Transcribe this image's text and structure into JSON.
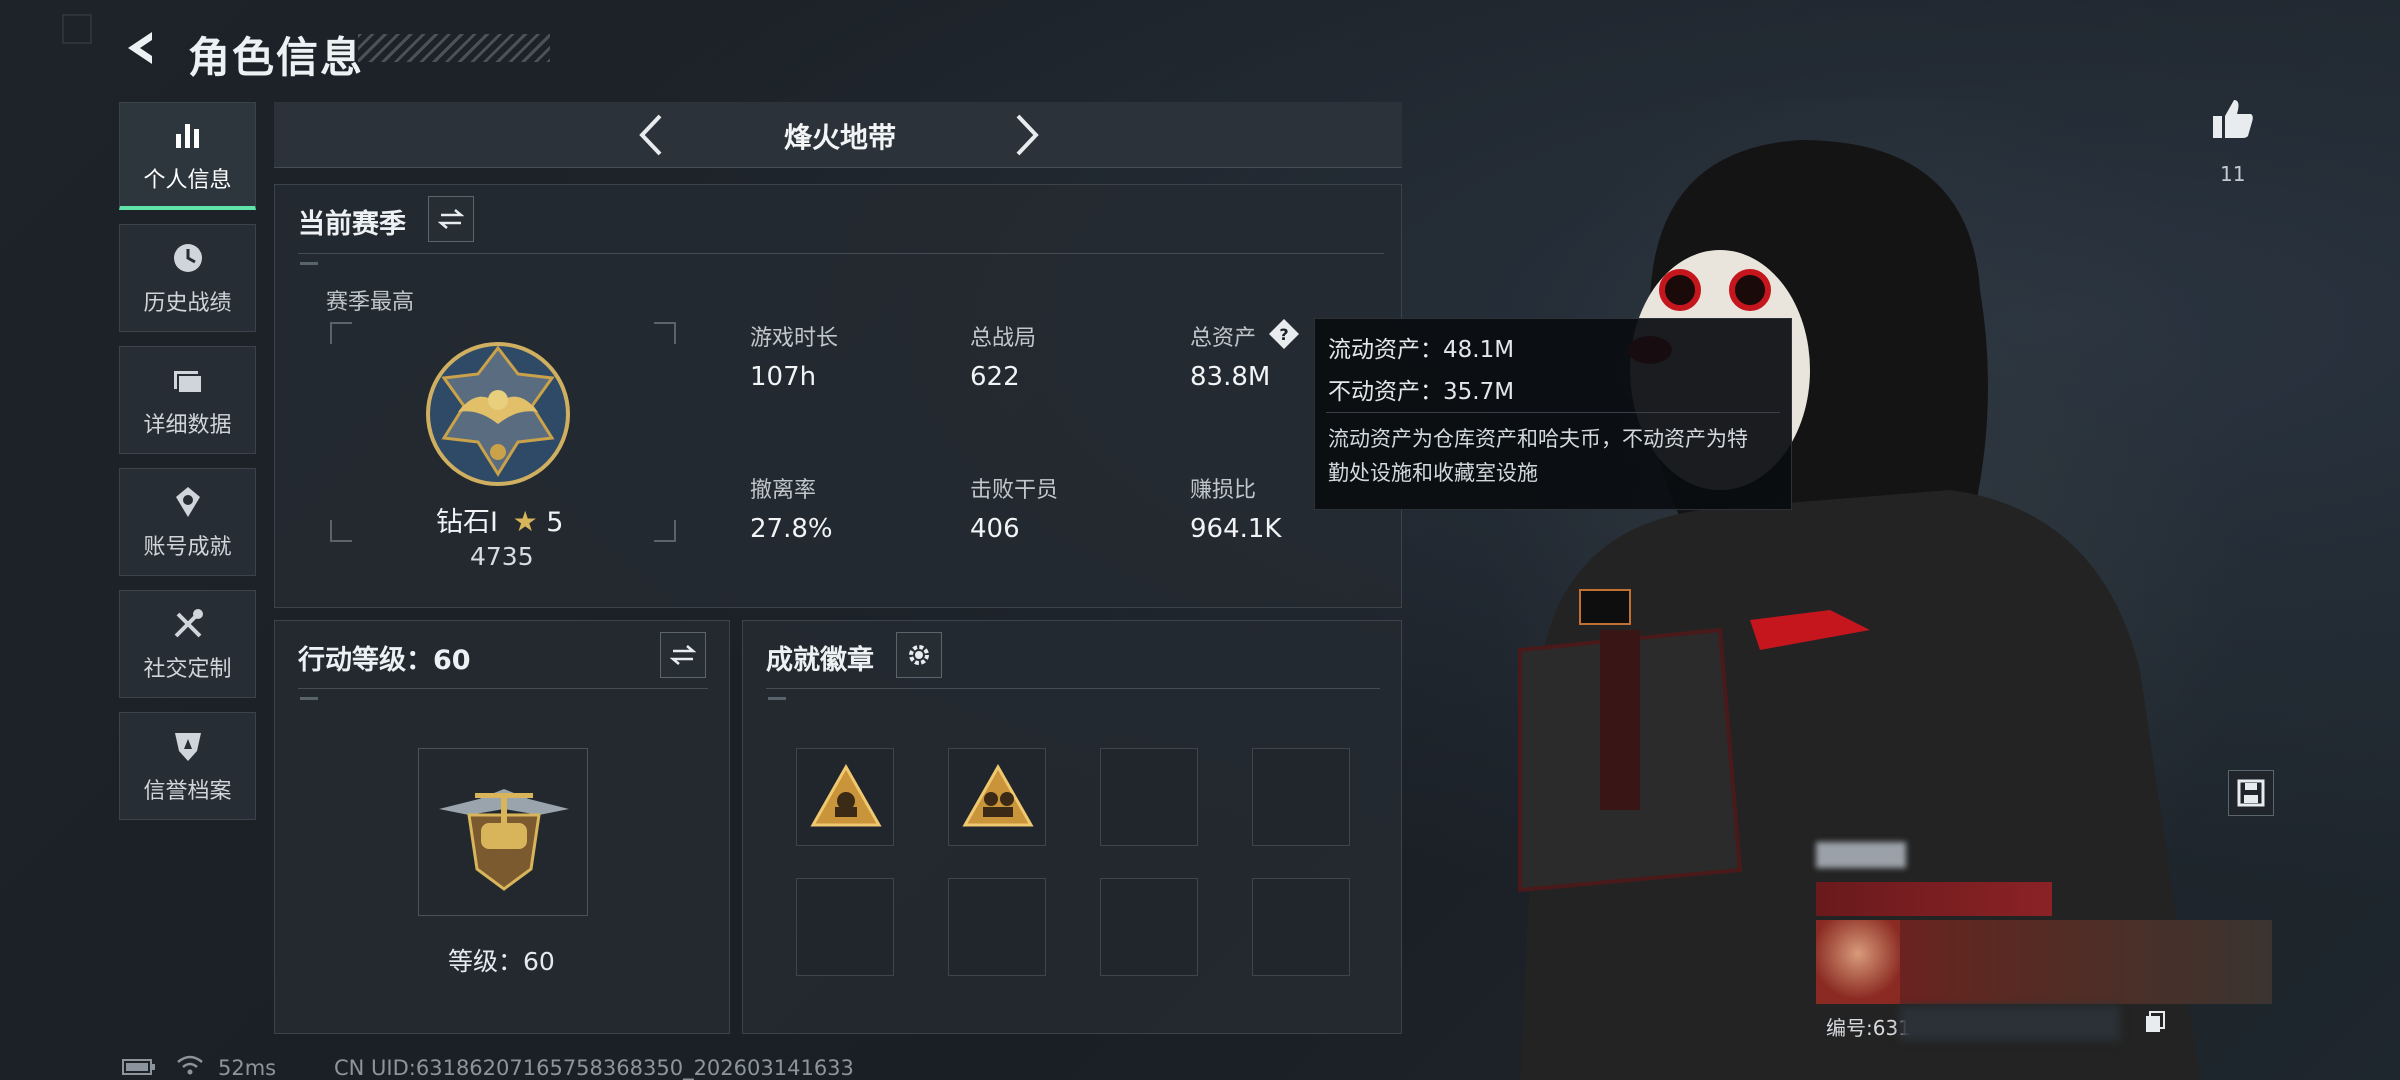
{
  "header": {
    "title": "角色信息"
  },
  "sidebar": {
    "items": [
      {
        "label": "个人信息",
        "icon": "bar-chart-icon",
        "active": true
      },
      {
        "label": "历史战绩",
        "icon": "clock-icon"
      },
      {
        "label": "详细数据",
        "icon": "folder-icon"
      },
      {
        "label": "账号成就",
        "icon": "achievement-icon"
      },
      {
        "label": "社交定制",
        "icon": "tools-icon"
      },
      {
        "label": "信誉档案",
        "icon": "shield-icon"
      }
    ]
  },
  "mode": {
    "title": "烽火地带"
  },
  "season": {
    "title": "当前赛季",
    "highest_label": "赛季最高",
    "rank_name": "钻石Ⅰ",
    "rank_stars": "5",
    "rank_points": "4735",
    "stats": [
      {
        "label": "游戏时长",
        "value": "107h"
      },
      {
        "label": "总战局",
        "value": "622"
      },
      {
        "label": "总资产",
        "value": "83.8M"
      },
      {
        "label": "撤离率",
        "value": "27.8%"
      },
      {
        "label": "击败干员",
        "value": "406"
      },
      {
        "label": "赚损比",
        "value": "964.1K"
      }
    ]
  },
  "tooltip": {
    "liquid": "流动资产：48.1M",
    "fixed": "不动资产：35.7M",
    "note": "流动资产为仓库资产和哈夫币，不动资产为特勤处设施和收藏室设施"
  },
  "action_level": {
    "title": "行动等级：60",
    "level_text": "等级：60"
  },
  "achievements": {
    "title": "成就徽章",
    "filled_slots": 2,
    "total_slots": 8
  },
  "like": {
    "count": "11"
  },
  "player_card": {
    "id_prefix": "编号:631"
  },
  "footer": {
    "ping": "52ms",
    "uid": "CN UID:63186207165758368350_202603141633"
  },
  "colors": {
    "accent": "#5fe3a8",
    "background": "#1b2026",
    "panel": "#242a31",
    "gold": "#c9a24a"
  }
}
